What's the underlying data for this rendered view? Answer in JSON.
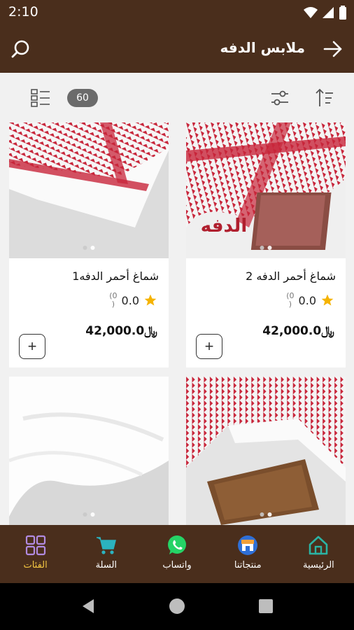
{
  "status": {
    "time": "2:10"
  },
  "header": {
    "title": "ملابس الدفه"
  },
  "toolbar": {
    "count": "60"
  },
  "products": [
    {
      "name": "شماغ أحمر الدفه 2",
      "rating": "0.0",
      "reviews": "(0\n)",
      "price": "42,000.0",
      "currency": "﷼",
      "image_text": "الدفه"
    },
    {
      "name": "شماغ أحمر الدفه1",
      "rating": "0.0",
      "reviews": "(0\n)",
      "price": "42,000.0",
      "currency": "﷼"
    },
    {
      "name": "",
      "rating": "",
      "reviews": "",
      "price": "",
      "currency": ""
    },
    {
      "name": "",
      "rating": "",
      "reviews": "",
      "price": "",
      "currency": ""
    }
  ],
  "bottom_nav": [
    {
      "label": "الرئيسية",
      "icon": "home-icon"
    },
    {
      "label": "منتجاتنا",
      "icon": "shop-icon"
    },
    {
      "label": "واتساب",
      "icon": "whatsapp-icon"
    },
    {
      "label": "السلة",
      "icon": "cart-icon"
    },
    {
      "label": "الفئات",
      "icon": "categories-icon",
      "active": true
    }
  ],
  "colors": {
    "brand": "#4a2e1c",
    "accent": "#f5c842",
    "star": "#f5b301"
  }
}
